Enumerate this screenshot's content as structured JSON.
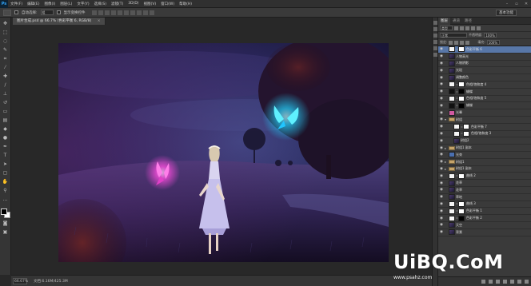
{
  "app": {
    "logo": "Ps"
  },
  "menu": [
    "文件(F)",
    "编辑(E)",
    "图像(I)",
    "图层(L)",
    "文字(Y)",
    "选择(S)",
    "滤镜(T)",
    "3D(D)",
    "视图(V)",
    "窗口(W)",
    "帮助(H)"
  ],
  "options": {
    "auto_select": "自动选择:",
    "auto_select_target": "组",
    "transform": "显示变换控件",
    "workspace": "基本功能"
  },
  "document": {
    "tab_title": "图片合成.psd @ 66.7% (色彩平衡 6, RGB/8)",
    "close": "×"
  },
  "status": {
    "zoom": "66.67%",
    "doc_info": "文档:6.16M/425.3M"
  },
  "layers_panel": {
    "tabs": [
      "图层",
      "通道",
      "路径"
    ],
    "filter": "类型",
    "blend_mode": "正常",
    "opacity_label": "不透明度:",
    "opacity": "100%",
    "lock_label": "锁定:",
    "fill_label": "填充:",
    "fill": "100%",
    "layers": [
      {
        "name": "色彩平衡 6",
        "thumb": "adj",
        "mask": "white",
        "selected": true,
        "indent": 0,
        "fold": ""
      },
      {
        "name": "人物高光",
        "thumb": "img",
        "indent": 0,
        "fold": ""
      },
      {
        "name": "人物阴影",
        "thumb": "img",
        "indent": 0,
        "fold": ""
      },
      {
        "name": "光斑",
        "thumb": "img",
        "indent": 0,
        "fold": ""
      },
      {
        "name": "调整颜色",
        "thumb": "img",
        "indent": 0,
        "fold": ""
      },
      {
        "name": "色相/饱和度 4",
        "thumb": "adj",
        "mask": "white",
        "indent": 0,
        "fold": ""
      },
      {
        "name": "蝴蝶",
        "thumb": "dark",
        "mask": "black",
        "indent": 0,
        "fold": ""
      },
      {
        "name": "色相/饱和度 5",
        "thumb": "adj",
        "mask": "white",
        "indent": 0,
        "fold": ""
      },
      {
        "name": "蝴蝶",
        "thumb": "dark",
        "mask": "black",
        "indent": 0,
        "fold": ""
      },
      {
        "name": "光晕",
        "thumb": "pink",
        "indent": 0,
        "fold": ""
      },
      {
        "name": "树组",
        "thumb": "folder",
        "indent": 0,
        "fold": "▾"
      },
      {
        "name": "色彩平衡 7",
        "thumb": "adj",
        "mask": "white",
        "indent": 1,
        "fold": ""
      },
      {
        "name": "色相/饱和度 3",
        "thumb": "adj",
        "mask": "white",
        "indent": 1,
        "fold": ""
      },
      {
        "name": "树组2",
        "thumb": "img",
        "indent": 1,
        "fold": ""
      },
      {
        "name": "树组1 副本",
        "thumb": "folder",
        "indent": 0,
        "fold": "▸"
      },
      {
        "name": "光束",
        "thumb": "blue",
        "indent": 0,
        "fold": ""
      },
      {
        "name": "树组1",
        "thumb": "folder",
        "indent": 0,
        "fold": "▸"
      },
      {
        "name": "树组1 副本",
        "thumb": "folder",
        "indent": 0,
        "fold": "▸"
      },
      {
        "name": "曲线 2",
        "thumb": "adj",
        "mask": "white",
        "indent": 0,
        "fold": ""
      },
      {
        "name": "花草",
        "thumb": "img",
        "indent": 0,
        "fold": ""
      },
      {
        "name": "花草",
        "thumb": "img",
        "indent": 0,
        "fold": ""
      },
      {
        "name": "草地",
        "thumb": "img",
        "indent": 0,
        "fold": ""
      },
      {
        "name": "曲线 3",
        "thumb": "adj",
        "mask": "white",
        "indent": 0,
        "fold": ""
      },
      {
        "name": "色彩平衡 1",
        "thumb": "adj",
        "mask": "white",
        "indent": 0,
        "fold": ""
      },
      {
        "name": "色彩平衡 2",
        "thumb": "adj",
        "mask": "black",
        "indent": 0,
        "fold": ""
      },
      {
        "name": "天空",
        "thumb": "img",
        "indent": 0,
        "fold": ""
      },
      {
        "name": "背景",
        "thumb": "img",
        "indent": 0,
        "fold": ""
      }
    ]
  },
  "watermark": {
    "logo": "UiBQ.CoM",
    "url": "www.psahz.com"
  },
  "colors": {
    "selected": "#5877a8",
    "butterfly_cyan": "#22d3ff",
    "butterfly_pink": "#ff4de0"
  }
}
